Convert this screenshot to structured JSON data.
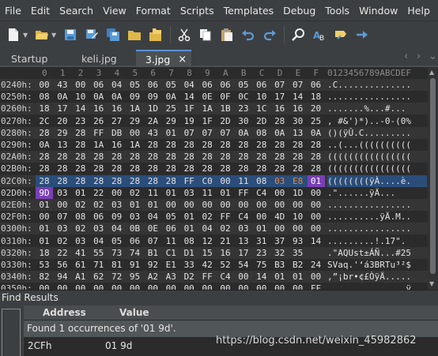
{
  "menu": [
    "File",
    "Edit",
    "Search",
    "View",
    "Format",
    "Scripts",
    "Templates",
    "Debug",
    "Tools",
    "Window",
    "Help"
  ],
  "toolbar_icons": [
    "new-file-icon",
    "open-folder-icon",
    "save-icon",
    "save-as-icon",
    "save-all-icon",
    "folder-icon",
    "folder-group-icon",
    "cut-icon",
    "copy-icon",
    "paste-icon",
    "undo-icon",
    "redo-icon",
    "find-icon",
    "replace-icon",
    "goto-icon",
    "next-icon"
  ],
  "tabs": [
    "Startup",
    "keli.jpg",
    "3.jpg"
  ],
  "active_tab": "3.jpg",
  "tab_close": "×",
  "tab_nav": [
    "‹",
    "›",
    "⌄"
  ],
  "hex": {
    "columns": [
      "0",
      "1",
      "2",
      "3",
      "4",
      "5",
      "6",
      "7",
      "8",
      "9",
      "A",
      "B",
      "C",
      "D",
      "E",
      "F"
    ],
    "ascii_header": "0123456789ABCDEF",
    "rows": [
      {
        "addr": "0240h:",
        "bytes": [
          "00",
          "43",
          "00",
          "06",
          "04",
          "05",
          "06",
          "05",
          "04",
          "06",
          "06",
          "05",
          "06",
          "07",
          "07",
          "06"
        ],
        "ascii": ".C.............."
      },
      {
        "addr": "0250h:",
        "bytes": [
          "08",
          "0A",
          "10",
          "0A",
          "0A",
          "09",
          "09",
          "0A",
          "14",
          "0E",
          "0F",
          "0C",
          "10",
          "17",
          "14",
          "18"
        ],
        "ascii": "................"
      },
      {
        "addr": "0260h:",
        "bytes": [
          "18",
          "17",
          "14",
          "16",
          "16",
          "1A",
          "1D",
          "25",
          "1F",
          "1A",
          "1B",
          "23",
          "1C",
          "16",
          "16",
          "20"
        ],
        "ascii": ".......%...#... "
      },
      {
        "addr": "0270h:",
        "bytes": [
          "2C",
          "20",
          "23",
          "26",
          "27",
          "29",
          "2A",
          "29",
          "19",
          "1F",
          "2D",
          "30",
          "2D",
          "28",
          "30",
          "25"
        ],
        "ascii": ", #&')*)..-0-(0%"
      },
      {
        "addr": "0280h:",
        "bytes": [
          "28",
          "29",
          "28",
          "FF",
          "DB",
          "00",
          "43",
          "01",
          "07",
          "07",
          "07",
          "0A",
          "08",
          "0A",
          "13",
          "0A"
        ],
        "ascii": "()(ÿÛ.C........."
      },
      {
        "addr": "0290h:",
        "bytes": [
          "0A",
          "13",
          "28",
          "1A",
          "16",
          "1A",
          "28",
          "28",
          "28",
          "28",
          "28",
          "28",
          "28",
          "28",
          "28",
          "28"
        ],
        "ascii": "..(...(((((((((("
      },
      {
        "addr": "02A0h:",
        "bytes": [
          "28",
          "28",
          "28",
          "28",
          "28",
          "28",
          "28",
          "28",
          "28",
          "28",
          "28",
          "28",
          "28",
          "28",
          "28",
          "28"
        ],
        "ascii": "(((((((((((((((("
      },
      {
        "addr": "02B0h:",
        "bytes": [
          "28",
          "28",
          "28",
          "28",
          "28",
          "28",
          "28",
          "28",
          "28",
          "28",
          "28",
          "28",
          "28",
          "28",
          "28",
          "28"
        ],
        "ascii": "(((((((((((((((("
      },
      {
        "addr": "02C0h:",
        "bytes": [
          "28",
          "28",
          "28",
          "28",
          "28",
          "28",
          "28",
          "28",
          "FF",
          "C0",
          "00",
          "11",
          "08",
          "03",
          "E8",
          "01"
        ],
        "ascii": "((((((((ÿÀ....è."
      },
      {
        "addr": "02D0h:",
        "bytes": [
          "9D",
          "03",
          "01",
          "22",
          "00",
          "02",
          "11",
          "01",
          "03",
          "11",
          "01",
          "FF",
          "C4",
          "00",
          "1D",
          "00"
        ],
        "ascii": ".\"......ÿÄ..."
      },
      {
        "addr": "02E0h:",
        "bytes": [
          "01",
          "00",
          "02",
          "02",
          "03",
          "01",
          "01",
          "00",
          "00",
          "00",
          "00",
          "00",
          "00",
          "00",
          "00",
          "00"
        ],
        "ascii": "................"
      },
      {
        "addr": "02F0h:",
        "bytes": [
          "00",
          "07",
          "08",
          "06",
          "09",
          "03",
          "04",
          "05",
          "01",
          "02",
          "FF",
          "C4",
          "00",
          "4D",
          "10",
          "00"
        ],
        "ascii": "..........ÿÄ.M.."
      },
      {
        "addr": "0300h:",
        "bytes": [
          "01",
          "03",
          "02",
          "03",
          "04",
          "0B",
          "0E",
          "06",
          "01",
          "04",
          "02",
          "03",
          "01",
          "00",
          "00",
          "00"
        ],
        "ascii": "................"
      },
      {
        "addr": "0310h:",
        "bytes": [
          "01",
          "02",
          "03",
          "04",
          "05",
          "06",
          "07",
          "11",
          "08",
          "12",
          "21",
          "13",
          "31",
          "37",
          "93",
          "14"
        ],
        "ascii": ".........!.17\"."
      },
      {
        "addr": "0320h:",
        "bytes": [
          "18",
          "22",
          "41",
          "55",
          "73",
          "74",
          "B1",
          "C1",
          "D1",
          "15",
          "16",
          "17",
          "23",
          "32",
          "35"
        ],
        "ascii": ".\"AQUst±ÁÑ...#25"
      },
      {
        "addr": "0330h:",
        "bytes": [
          "53",
          "56",
          "61",
          "71",
          "81",
          "91",
          "92",
          "E1",
          "33",
          "42",
          "52",
          "54",
          "75",
          "B3",
          "B2",
          "24"
        ],
        "ascii": "SVaq.'‘á3BRTu³²$"
      },
      {
        "addr": "0340h:",
        "bytes": [
          "82",
          "94",
          "A1",
          "62",
          "72",
          "95",
          "A2",
          "A3",
          "D2",
          "FF",
          "C4",
          "00",
          "14",
          "01",
          "01",
          "00"
        ],
        "ascii": ",”¡br•¢£ÒÿÄ....."
      },
      {
        "addr": "0350h:",
        "bytes": [
          "00",
          "00",
          "00",
          "00",
          "00",
          "00",
          "00",
          "00",
          "00",
          "00",
          "00",
          "00",
          "00",
          "00",
          "00",
          "FF"
        ],
        "ascii": "...............ÿ"
      }
    ]
  },
  "find_results": {
    "title": "Find Results",
    "headers": [
      "Address",
      "Value"
    ],
    "summary": "Found 1 occurrences of '01 9d'.",
    "rows": [
      {
        "address": "2CFh",
        "value": "01 9d"
      }
    ]
  },
  "watermark": "https://blog.csdn.net/weixin_45982862",
  "colors": {
    "accent_tab": "#5a8fd6",
    "highlight_row": "#2b4d7a",
    "match_purple": "#7a3fb5",
    "orange_bytes": "#e08a3a"
  }
}
